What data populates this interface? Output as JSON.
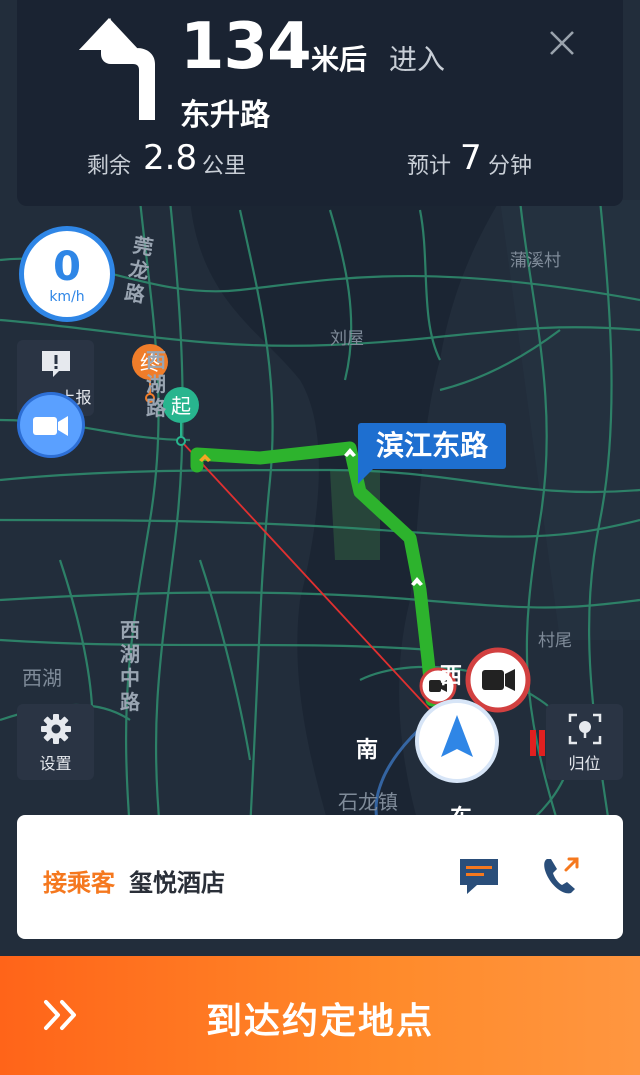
{
  "navigation": {
    "distance": "134",
    "distance_unit": "米后",
    "action": "进入",
    "road": "东升路",
    "remaining_label": "剩余",
    "remaining_value": "2.8",
    "remaining_unit": "公里",
    "eta_label": "预计",
    "eta_value": "7",
    "eta_unit": "分钟",
    "turn_icon": "turn-left-icon",
    "close_icon": "close-icon"
  },
  "speed": {
    "value": "0",
    "unit": "km/h"
  },
  "side_buttons": {
    "report_label": "上报",
    "settings_label": "设置",
    "locate_label": "归位"
  },
  "map": {
    "route_tag": "滨江东路",
    "start_marker": "起",
    "end_marker": "终",
    "place_labels": [
      "莞龙路",
      "刘屋",
      "蒲溪村",
      "西湖路",
      "西湖中路",
      "西湖",
      "村尾",
      "石龙镇",
      "南",
      "西",
      "东"
    ],
    "route_color": "#2db32d",
    "accent_blue": "#2f86e6"
  },
  "passenger": {
    "pickup_label": "接乘客",
    "place": "玺悦酒店",
    "message_icon": "message-icon",
    "call_icon": "phone-icon"
  },
  "arrive_button": {
    "label": "到达约定地点"
  }
}
